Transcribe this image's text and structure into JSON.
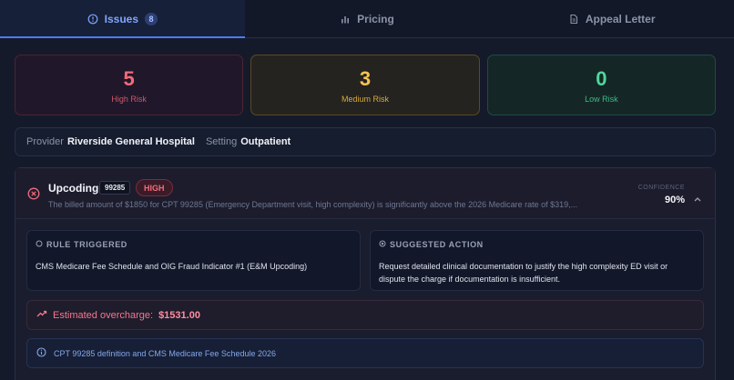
{
  "tabs": [
    {
      "label": "Issues",
      "icon": "alert-circle-icon",
      "count": "8",
      "active": true
    },
    {
      "label": "Pricing",
      "icon": "bar-chart-icon",
      "active": false
    },
    {
      "label": "Appeal Letter",
      "icon": "document-icon",
      "active": false
    }
  ],
  "summary": {
    "high": {
      "count": "5",
      "label": "High Risk",
      "color": "#f26b7a"
    },
    "medium": {
      "count": "3",
      "label": "Medium Risk",
      "color": "#f5c451"
    },
    "low": {
      "count": "0",
      "label": "Low Risk",
      "color": "#4fd79b"
    }
  },
  "provider": {
    "provider_label": "Provider",
    "provider_value": "Riverside General Hospital",
    "setting_label": "Setting",
    "setting_value": "Outpatient"
  },
  "issue": {
    "title": "Upcoding",
    "code": "99285",
    "severity": "HIGH",
    "description": "The billed amount of $1850 for CPT 99285 (Emergency Department visit, high complexity) is significantly above the 2026 Medicare rate of $319,...",
    "confidence_label": "CONFIDENCE",
    "confidence_value": "90%",
    "rule_heading": "RULE TRIGGERED",
    "rule_text": "CMS Medicare Fee Schedule and OIG Fraud Indicator #1 (E&M Upcoding)",
    "action_heading": "SUGGESTED ACTION",
    "action_text": "Request detailed clinical documentation to justify the high complexity ED visit or dispute the charge if documentation is insufficient.",
    "overcharge_label": "Estimated overcharge:",
    "overcharge_value": "$1531.00",
    "reference": "CPT 99285 definition and CMS Medicare Fee Schedule 2026"
  }
}
